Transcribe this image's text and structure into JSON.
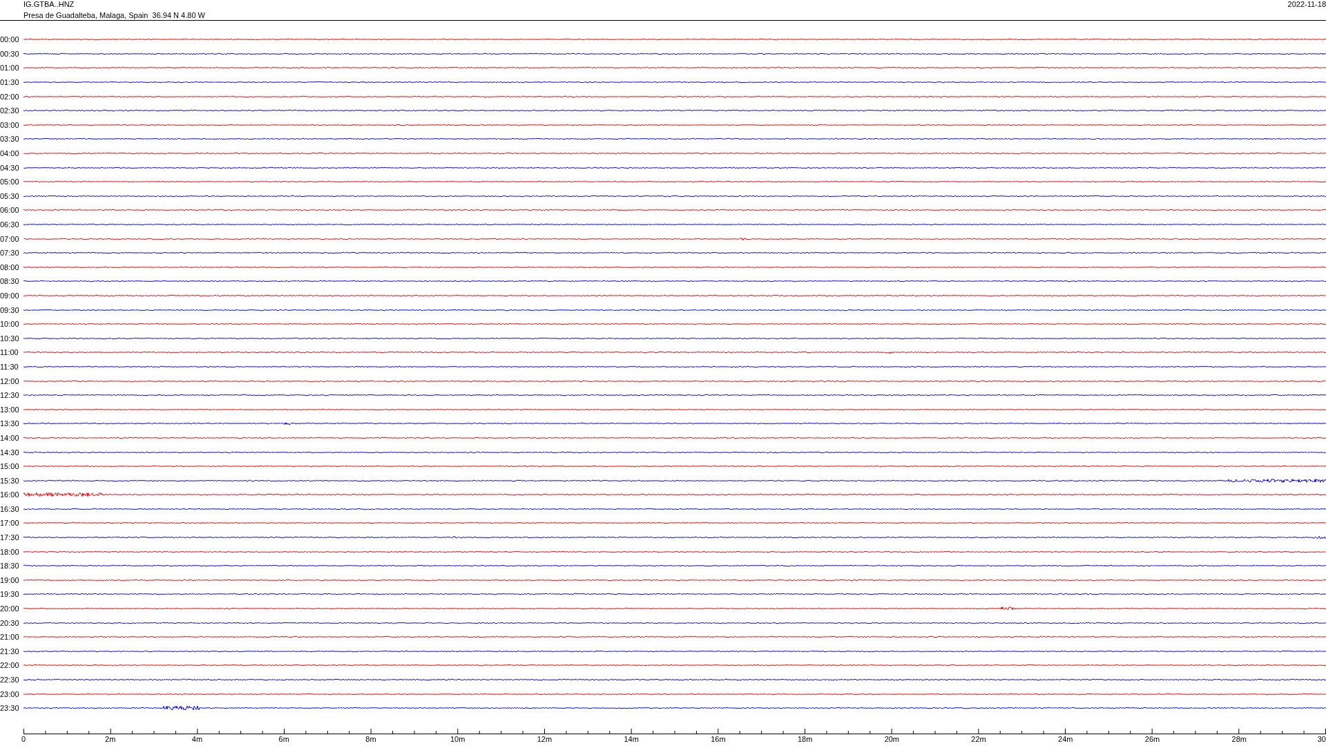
{
  "header": {
    "station": "IG.GTBA..HNZ",
    "location": "Presa de Guadalteba, Malaga, Spain  36.94 N 4.80 W",
    "date": "2022-11-18"
  },
  "traces": [
    {
      "label": "00:00",
      "color": "#ff0000"
    },
    {
      "label": "00:30",
      "color": "#0000ff"
    },
    {
      "label": "01:00",
      "color": "#ff0000"
    },
    {
      "label": "01:30",
      "color": "#0000ff"
    },
    {
      "label": "02:00",
      "color": "#ff0000"
    },
    {
      "label": "02:30",
      "color": "#0000ff"
    },
    {
      "label": "03:00",
      "color": "#ff0000"
    },
    {
      "label": "03:30",
      "color": "#0000ff"
    },
    {
      "label": "04:00",
      "color": "#ff0000"
    },
    {
      "label": "04:30",
      "color": "#0000ff"
    },
    {
      "label": "05:00",
      "color": "#ff0000"
    },
    {
      "label": "05:30",
      "color": "#0000ff"
    },
    {
      "label": "06:00",
      "color": "#ff0000"
    },
    {
      "label": "06:30",
      "color": "#0000ff"
    },
    {
      "label": "07:00",
      "color": "#ff0000"
    },
    {
      "label": "07:30",
      "color": "#0000ff"
    },
    {
      "label": "08:00",
      "color": "#ff0000"
    },
    {
      "label": "08:30",
      "color": "#0000ff"
    },
    {
      "label": "09:00",
      "color": "#ff0000"
    },
    {
      "label": "09:30",
      "color": "#0000ff"
    },
    {
      "label": "10:00",
      "color": "#ff0000"
    },
    {
      "label": "10:30",
      "color": "#0000ff"
    },
    {
      "label": "11:00",
      "color": "#ff0000"
    },
    {
      "label": "11:30",
      "color": "#0000ff"
    },
    {
      "label": "12:00",
      "color": "#ff0000"
    },
    {
      "label": "12:30",
      "color": "#0000ff"
    },
    {
      "label": "13:00",
      "color": "#ff0000"
    },
    {
      "label": "13:30",
      "color": "#0000ff"
    },
    {
      "label": "14:00",
      "color": "#ff0000"
    },
    {
      "label": "14:30",
      "color": "#0000ff"
    },
    {
      "label": "15:00",
      "color": "#ff0000"
    },
    {
      "label": "15:30",
      "color": "#0000ff"
    },
    {
      "label": "16:00",
      "color": "#ff0000"
    },
    {
      "label": "16:30",
      "color": "#0000ff"
    },
    {
      "label": "17:00",
      "color": "#ff0000"
    },
    {
      "label": "17:30",
      "color": "#0000ff"
    },
    {
      "label": "18:00",
      "color": "#ff0000"
    },
    {
      "label": "18:30",
      "color": "#0000ff"
    },
    {
      "label": "19:00",
      "color": "#ff0000"
    },
    {
      "label": "19:30",
      "color": "#0000ff"
    },
    {
      "label": "20:00",
      "color": "#ff0000"
    },
    {
      "label": "20:30",
      "color": "#0000ff"
    },
    {
      "label": "21:00",
      "color": "#ff0000"
    },
    {
      "label": "21:30",
      "color": "#0000ff"
    },
    {
      "label": "22:00",
      "color": "#ff0000"
    },
    {
      "label": "22:30",
      "color": "#0000ff"
    },
    {
      "label": "23:00",
      "color": "#ff0000"
    },
    {
      "label": "23:30",
      "color": "#0000ff"
    }
  ],
  "x_axis": {
    "labels": [
      "0",
      "2m",
      "4m",
      "6m",
      "8m",
      "10m",
      "12m",
      "14m",
      "16m",
      "18m",
      "20m",
      "22m",
      "24m",
      "26m",
      "28m",
      "30"
    ]
  }
}
